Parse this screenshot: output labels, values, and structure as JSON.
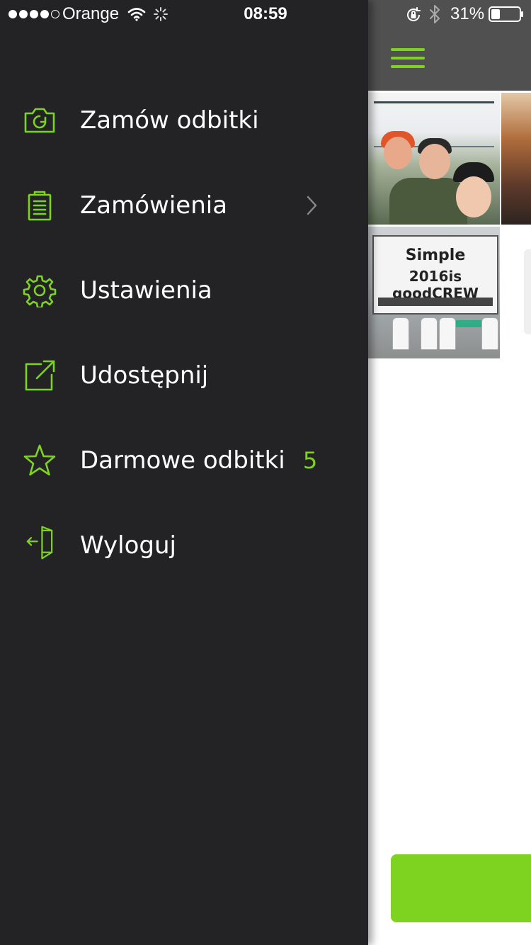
{
  "status_bar": {
    "carrier": "Orange",
    "time": "08:59",
    "battery_percent": "31%",
    "signal_bars": 4,
    "signal_total": 5,
    "battery_level": 0.31,
    "icons": [
      "wifi-icon",
      "activity-icon",
      "rotation-lock-icon",
      "bluetooth-icon",
      "battery-icon"
    ]
  },
  "colors": {
    "accent": "#7ed321",
    "drawer_bg": "#232325",
    "header_bg": "#505050",
    "text": "#ffffff"
  },
  "drawer": {
    "items": [
      {
        "id": "order-prints",
        "label": "Zamów odbitki",
        "icon": "camera-icon"
      },
      {
        "id": "orders",
        "label": "Zamówienia",
        "icon": "clipboard-icon",
        "has_chevron": true
      },
      {
        "id": "settings",
        "label": "Ustawienia",
        "icon": "gear-icon"
      },
      {
        "id": "share",
        "label": "Udostępnij",
        "icon": "share-icon"
      },
      {
        "id": "free-prints",
        "label": "Darmowe odbitki",
        "icon": "star-icon",
        "badge": "5"
      },
      {
        "id": "logout",
        "label": "Wyloguj",
        "icon": "logout-door-icon"
      }
    ]
  },
  "main": {
    "header": {
      "menu_icon": "hamburger-icon"
    },
    "photo_board": {
      "line1": "Simple",
      "line2": "2016is goodCREW"
    }
  }
}
